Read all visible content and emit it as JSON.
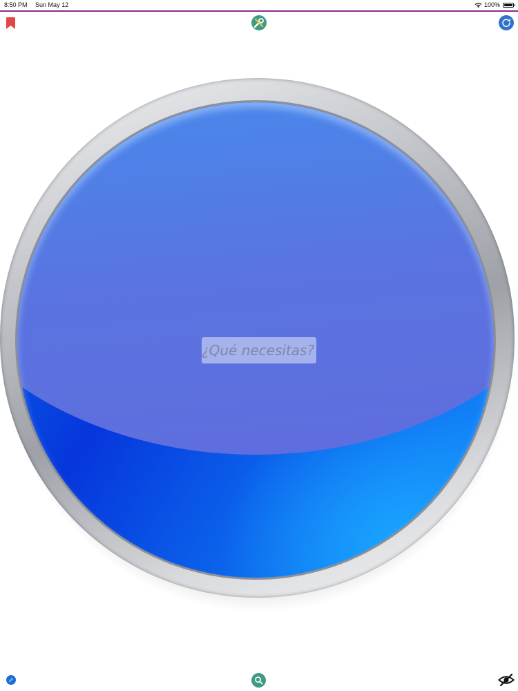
{
  "status_bar": {
    "time": "8:50 PM",
    "date": "Sun May 12",
    "battery": "100%"
  },
  "search": {
    "placeholder": "¿Qué necesitas?"
  },
  "icons": {
    "top_left": "bookmark-icon",
    "top_center": "tools-icon",
    "top_right": "refresh-icon",
    "bottom_left": "compass-icon",
    "bottom_center": "search-icon",
    "bottom_right": "eye-off-icon"
  },
  "colors": {
    "status_accent": "#8a2a8e",
    "bookmark": "#e04848",
    "tools_bg": "#3e9c86",
    "refresh_bg": "#2f74c9",
    "orb_blue": "#0636dc"
  }
}
